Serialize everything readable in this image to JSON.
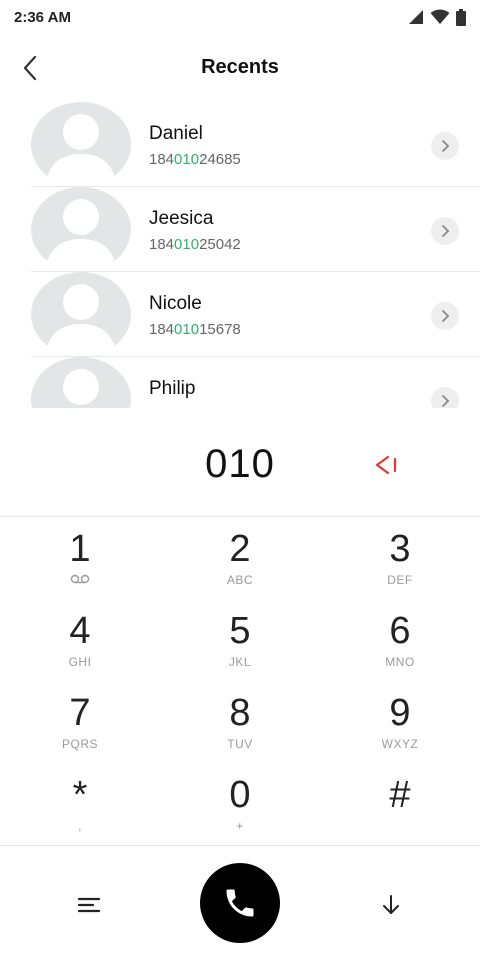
{
  "status_bar": {
    "time": "2:36 AM",
    "icons": [
      "signal-icon",
      "wifi-icon",
      "battery-icon"
    ]
  },
  "header": {
    "title": "Recents",
    "back_icon": "back-chevron-icon"
  },
  "recents": [
    {
      "name": "Daniel",
      "number_prefix": "184",
      "number_match": "010",
      "number_suffix": "24685"
    },
    {
      "name": "Jeesica",
      "number_prefix": "184",
      "number_match": "010",
      "number_suffix": "25042"
    },
    {
      "name": "Nicole",
      "number_prefix": "184",
      "number_match": "010",
      "number_suffix": "15678"
    },
    {
      "name": "Philip",
      "number_prefix": "",
      "number_match": "",
      "number_suffix": ""
    }
  ],
  "dialer": {
    "number": "010",
    "backspace_icon": "backspace-icon"
  },
  "keypad": {
    "keys": [
      {
        "digit": "1",
        "sub": ""
      },
      {
        "digit": "2",
        "sub": "ABC"
      },
      {
        "digit": "3",
        "sub": "DEF"
      },
      {
        "digit": "4",
        "sub": "GHI"
      },
      {
        "digit": "5",
        "sub": "JKL"
      },
      {
        "digit": "6",
        "sub": "MNO"
      },
      {
        "digit": "7",
        "sub": "PQRS"
      },
      {
        "digit": "8",
        "sub": "TUV"
      },
      {
        "digit": "9",
        "sub": "WXYZ"
      },
      {
        "digit": "*",
        "sub": ","
      },
      {
        "digit": "0",
        "sub": "+"
      },
      {
        "digit": "#",
        "sub": ""
      }
    ]
  },
  "bottom_bar": {
    "icons": [
      "menu-icon",
      "phone-call-icon",
      "arrow-down-icon"
    ]
  },
  "colors": {
    "match_highlight": "#2db36b",
    "backspace": "#e53935",
    "call_button": "#000000"
  }
}
